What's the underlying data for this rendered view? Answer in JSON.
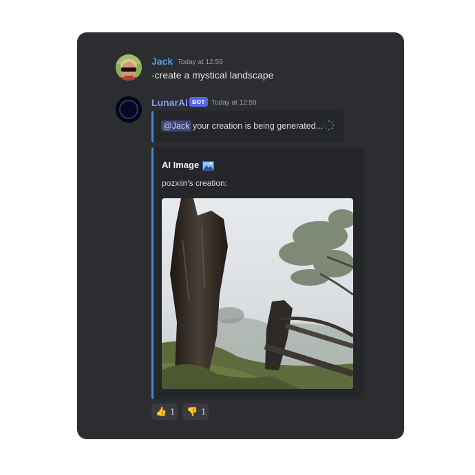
{
  "messages": [
    {
      "author": "Jack",
      "author_color": "#4b9fe0",
      "timestamp": "Today at 12:59",
      "text": "-create a mystical landscape"
    },
    {
      "author": "LunarAI",
      "author_color": "#8f93f7",
      "badge": "BOT",
      "timestamp": "Today at 12:59",
      "reply": {
        "mention": "@Jack",
        "text": "your creation is being generated..."
      },
      "embed": {
        "title": "AI Image",
        "icon": "image-icon",
        "description": "pozxiin's creation:",
        "accent_color": "#3f88d8"
      }
    }
  ],
  "reactions": [
    {
      "emoji": "👍",
      "icon": "thumbs-up-icon",
      "count": "1"
    },
    {
      "emoji": "👎",
      "icon": "thumbs-down-icon",
      "count": "1"
    }
  ]
}
